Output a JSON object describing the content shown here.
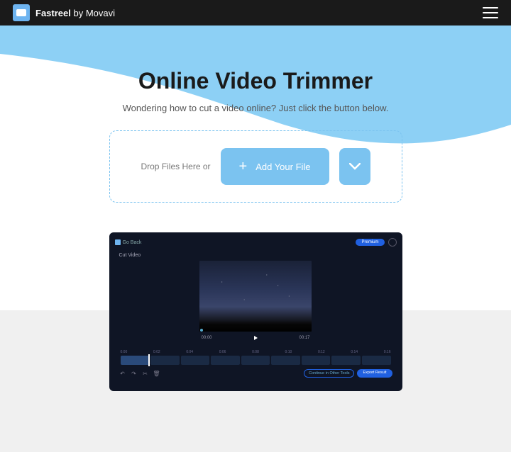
{
  "header": {
    "brand_bold": "Fastreel",
    "brand_rest": " by Movavi"
  },
  "hero": {
    "title": "Online Video Trimmer",
    "subtitle": "Wondering how to cut a video online? Just click the button below."
  },
  "upload": {
    "drop_text": "Drop Files Here or",
    "add_label": "Add Your File"
  },
  "preview": {
    "back_label": "Go Back",
    "premium": "Premium",
    "cut_label": "Cut Video",
    "time_start": "00:00",
    "time_end": "00:17",
    "ticks": [
      "0:00",
      "0:02",
      "0:04",
      "0:06",
      "0:08",
      "0:10",
      "0:12",
      "0:14",
      "0:16"
    ],
    "continue_label": "Continue in Other Tools",
    "export_label": "Export Result"
  }
}
